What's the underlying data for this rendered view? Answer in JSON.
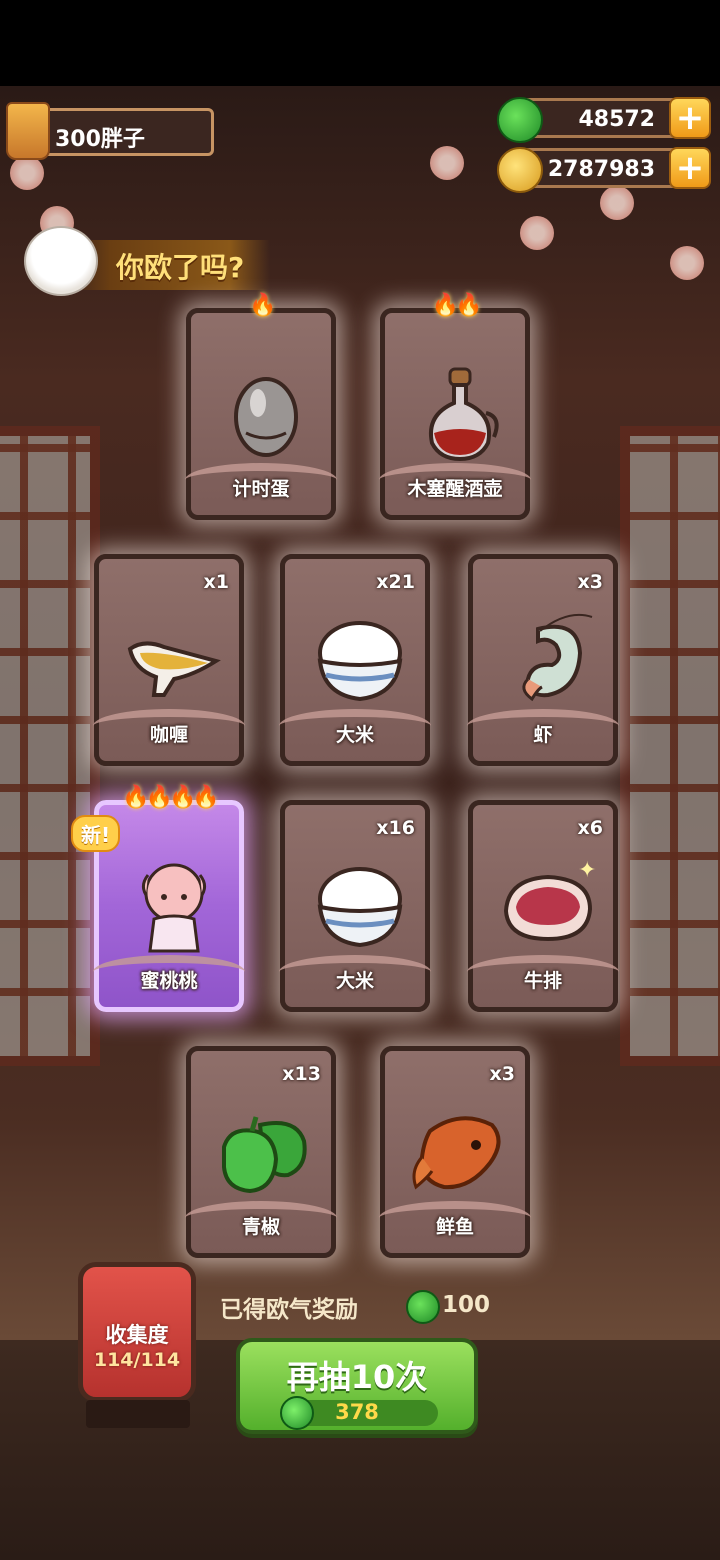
{
  "player": {
    "name": "300胖子"
  },
  "resources": [
    {
      "kind": "jade",
      "value": "48572",
      "plus": "+"
    },
    {
      "kind": "coin",
      "value": "2787983",
      "plus": "+"
    }
  ],
  "banner": {
    "title": "你欧了吗?"
  },
  "cards": [
    {
      "label": "计时蛋",
      "count": "",
      "flames": "🔥",
      "icon": "egg-timer-icon",
      "new": false
    },
    {
      "label": "木塞醒酒壶",
      "count": "",
      "flames": "🔥🔥",
      "icon": "decanter-icon",
      "new": false
    },
    {
      "label": "咖喱",
      "count": "x1",
      "flames": "",
      "icon": "curry-gravy-boat-icon",
      "new": false
    },
    {
      "label": "大米",
      "count": "x21",
      "flames": "",
      "icon": "rice-bowl-icon",
      "new": false
    },
    {
      "label": "虾",
      "count": "x3",
      "flames": "",
      "icon": "shrimp-icon",
      "new": false
    },
    {
      "label": "蜜桃桃",
      "count": "",
      "flames": "🔥🔥🔥🔥",
      "icon": "peach-girl-character-icon",
      "new": true,
      "new_label": "新!"
    },
    {
      "label": "大米",
      "count": "x16",
      "flames": "",
      "icon": "rice-bowl-icon",
      "new": false
    },
    {
      "label": "牛排",
      "count": "x6",
      "flames": "",
      "icon": "steak-icon",
      "new": false
    },
    {
      "label": "青椒",
      "count": "x13",
      "flames": "",
      "icon": "green-pepper-icon",
      "new": false
    },
    {
      "label": "鲜鱼",
      "count": "x3",
      "flames": "",
      "icon": "fish-icon",
      "new": false
    }
  ],
  "collection": {
    "title": "收集度",
    "progress": "114/114"
  },
  "reward": {
    "label": "已得欧气奖励",
    "value": "100"
  },
  "draw_button": {
    "label": "再抽10次",
    "cost": "378"
  },
  "colors": {
    "jade": "#3cb43c",
    "coin": "#f0b82a",
    "button_green": "#6ec43a",
    "card_brown": "#8a6a65",
    "special_purple": "#b077de"
  }
}
